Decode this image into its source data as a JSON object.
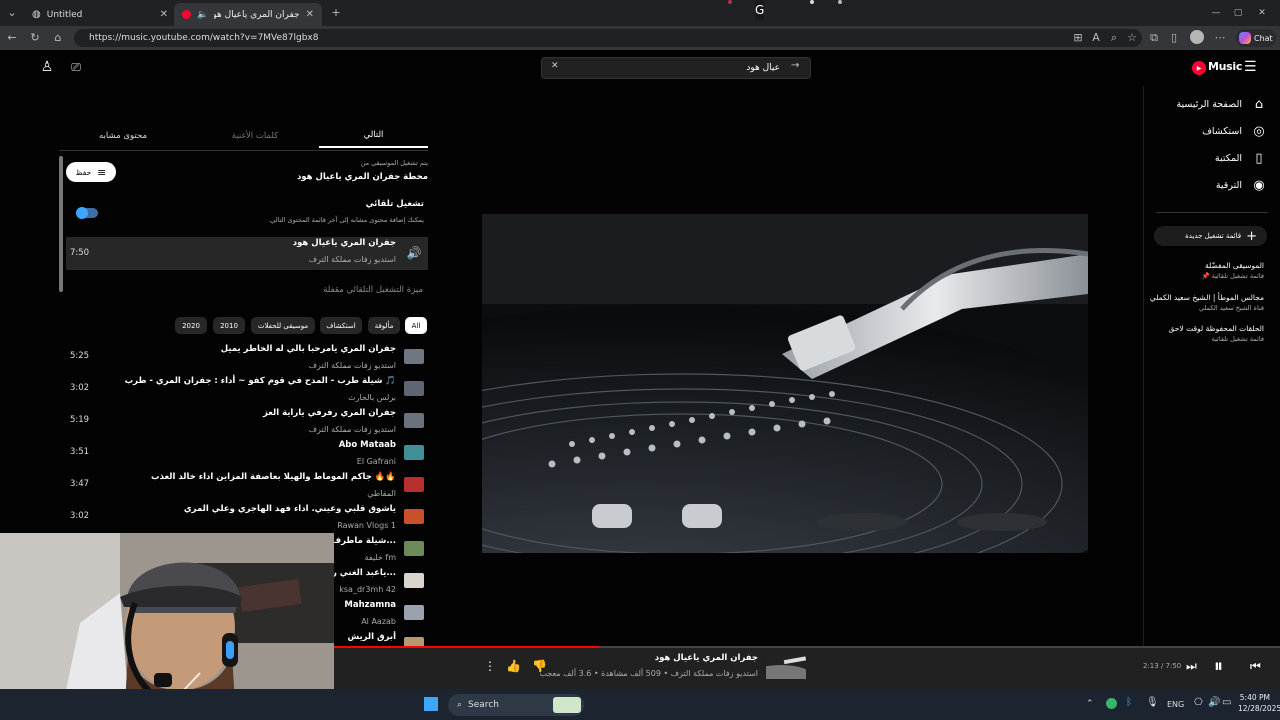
{
  "browser": {
    "tabs": [
      {
        "title": "Untitled",
        "active": false
      },
      {
        "title": "جفران المري ياعيال هود - YouTube Music",
        "active": true
      }
    ],
    "url": "https://music.youtube.com/watch?v=7MVe87lgbx8",
    "chat_label": "Chat"
  },
  "header": {
    "search_query": "عيال هود",
    "logo_text": "Music"
  },
  "nav": {
    "items": [
      {
        "label": "الصفحة الرئيسية",
        "icon": "home-icon"
      },
      {
        "label": "استكشاف",
        "icon": "explore-icon"
      },
      {
        "label": "المكتبة",
        "icon": "library-icon"
      },
      {
        "label": "الترقية",
        "icon": "upgrade-icon"
      }
    ],
    "new_playlist": "قائمة تشغيل جديدة",
    "playlists": [
      {
        "title": "الموسيقى المفضّلة",
        "subtitle": "قائمة تشغيل تلقائية"
      },
      {
        "title": "مجالس الموطأ | الشيخ سعيد الكملي",
        "subtitle": "قناة الشيخ سعيد الكملي"
      },
      {
        "title": "الحلقات المحفوظة لوقت لاحق",
        "subtitle": "قائمة تشغيل تلقائية"
      }
    ]
  },
  "queue": {
    "tabs": [
      "التالي",
      "كلمات الأغنية",
      "محتوى مشابه"
    ],
    "playing_from_label": "يتم تشغيل الموسيقى من",
    "playing_from": "محطة جفران المري ياعيال هود",
    "save_label": "حفظ",
    "autoplay_title": "تشغيل تلقائي",
    "autoplay_desc": "يمكنك إضافة محتوى مشابه إلى آخر قائمة المحتوى التالي.",
    "current": {
      "title": "جفران المري ياعيال هود",
      "artist": "استديو زفات مملكة الترف",
      "duration": "7:50"
    },
    "autoplay_off": "ميزة التشغيل التلقائي مقفلة",
    "chips": [
      "All",
      "مألوفة",
      "استكشاف",
      "موسيقى للحفلات",
      "2010",
      "2020"
    ],
    "items": [
      {
        "title": "جفران المري يامرحبا بالي له الخاطر يميل",
        "artist": "استديو زفات مملكة الترف",
        "duration": "5:25"
      },
      {
        "title": "شيلة طرب - المدح في قوم كفو ~ أداء : جفران المري - طرب 🎵",
        "artist": "برلس بالحارث",
        "duration": "3:02"
      },
      {
        "title": "جفران المري رفرفي ياراية العز",
        "artist": "استديو زفات مملكة الترف",
        "duration": "5:19"
      },
      {
        "title": "Abo Mataab",
        "artist": "El Gafrani",
        "duration": "3:51"
      },
      {
        "title": "جاكم الموماط والهيلا بعاصفة المزاين اداء خالد العذب 🔥🔥",
        "artist": "المقاطي",
        "duration": "3:47"
      },
      {
        "title": "ياشوق قلبي وعيني. اداء فهد الهاجري وعلي المري",
        "artist": "Rawan Vlogs 1",
        "duration": "3:02"
      },
      {
        "title": "شيلة ماطرف النوم...",
        "artist": "خليفة fm",
        "duration": ""
      },
      {
        "title": "ياعبد الغني ربك اذا...",
        "artist": "ksa_dr3mh 42",
        "duration": ""
      },
      {
        "title": "Mahzamna",
        "artist": "Al Aazab",
        "duration": ""
      },
      {
        "title": "أبرق الريش",
        "artist": "",
        "duration": ""
      }
    ]
  },
  "player": {
    "time": "2:13 / 7:50",
    "title": "جفران المري ياعيال هود",
    "meta": "استديو زفات مملكة الترف • 509 ألف مشاهدة • 3.6 ألف معجب",
    "progress": 0.28
  },
  "taskbar": {
    "search": "Search",
    "lang": "ENG",
    "time": "5:40 PM",
    "date": "12/28/2025"
  }
}
